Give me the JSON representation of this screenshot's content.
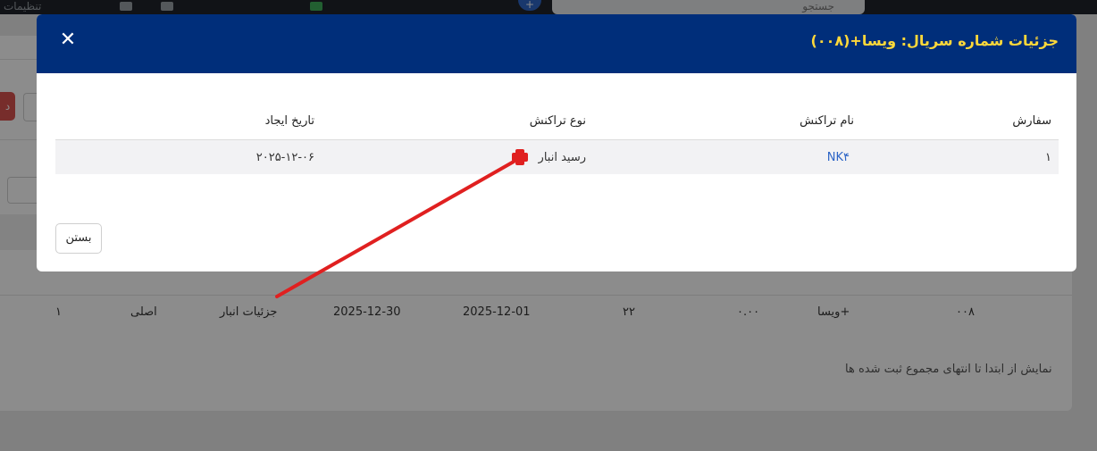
{
  "app": {
    "settings_label": "تنظیمات",
    "search_placeholder": "جستجو",
    "add_symbol": "+"
  },
  "background": {
    "red_button_label": "د",
    "rows": [
      {
        "serial": "۰۰۸",
        "name": "ویسا+",
        "amount": "۰.۰۰",
        "count": "۲۲",
        "date_start": "2025-12-01",
        "date_end": "2025-12-30",
        "details": "جزئیات انبار",
        "type": "اصلی",
        "order": "۱"
      }
    ],
    "footer_text": "نمایش از ابتدا تا انتهای مجموع ثبت شده ها"
  },
  "modal": {
    "title": "جزئیات شماره سریال: ویسا+(۰۰۸)",
    "close_symbol": "✕",
    "columns": {
      "order": "سفارش",
      "transaction_name": "نام تراکنش",
      "transaction_type": "نوع تراکنش",
      "created_date": "تاریخ ایجاد"
    },
    "rows": [
      {
        "order": "۱",
        "transaction_name": "NK۴",
        "transaction_type": "رسید انبار",
        "created_date": "۲۰۲۵-۱۲-۰۶"
      }
    ],
    "close_button_label": "بستن"
  },
  "colors": {
    "header_bg": "#002e7a",
    "title_color": "#ffd83a",
    "link_color": "#2d65c6",
    "annotation_red": "#e02020"
  }
}
